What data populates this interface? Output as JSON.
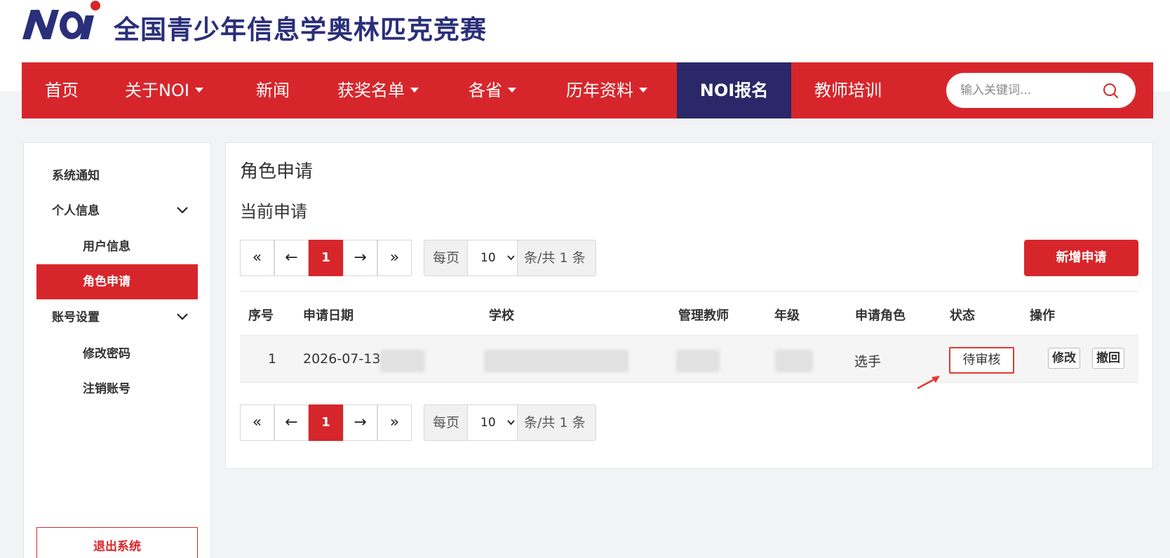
{
  "header": {
    "site_title": "全国青少年信息学奥林匹克竞赛",
    "logo_text": "NOI"
  },
  "nav": {
    "items": [
      {
        "label": "首页",
        "dropdown": false
      },
      {
        "label": "关于NOI",
        "dropdown": true
      },
      {
        "label": "新闻",
        "dropdown": false
      },
      {
        "label": "获奖名单",
        "dropdown": true
      },
      {
        "label": "各省",
        "dropdown": true
      },
      {
        "label": "历年资料",
        "dropdown": true
      },
      {
        "label": "NOI报名",
        "dropdown": false,
        "active": true
      },
      {
        "label": "教师培训",
        "dropdown": false
      }
    ],
    "search_placeholder": "输入关键词..."
  },
  "sidebar": {
    "items": [
      {
        "label": "系统通知"
      },
      {
        "label": "个人信息",
        "expandable": true
      },
      {
        "label": "用户信息",
        "sub": true
      },
      {
        "label": "角色申请",
        "sub": true,
        "active": true
      },
      {
        "label": "账号设置",
        "expandable": true
      },
      {
        "label": "修改密码",
        "sub": true
      },
      {
        "label": "注销账号",
        "sub": true
      }
    ],
    "logout_label": "退出系统"
  },
  "main": {
    "title": "角色申请",
    "section_title": "当前申请",
    "pager": {
      "first": "«",
      "prev": "←",
      "current_page": "1",
      "next": "→",
      "last": "»",
      "per_page_label": "每页",
      "page_size": "10",
      "total_label": "条/共 1 条"
    },
    "add_button": "新增申请",
    "table": {
      "headers": [
        "序号",
        "申请日期",
        "学校",
        "管理教师",
        "年级",
        "申请角色",
        "状态",
        "操作"
      ],
      "rows": [
        {
          "index": "1",
          "date": "2026-07-13 0",
          "role": "选手",
          "status": "待审核",
          "actions": [
            "修改",
            "撤回"
          ]
        }
      ]
    }
  },
  "colors": {
    "brand_red": "#d7262b",
    "nav_active": "#2a2868",
    "title_navy": "#2a2f7a"
  }
}
